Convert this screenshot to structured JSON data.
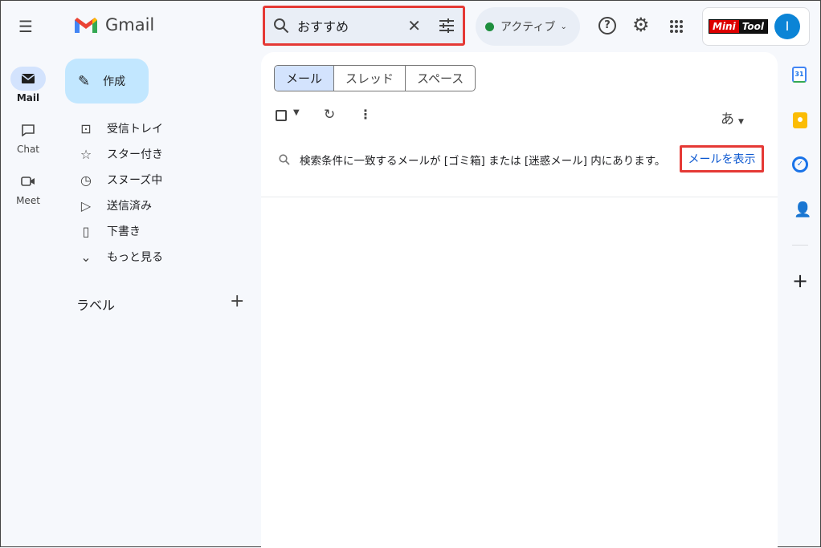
{
  "app": {
    "name": "Gmail"
  },
  "rail": [
    {
      "label": "Mail",
      "icon": "mail-icon"
    },
    {
      "label": "Chat",
      "icon": "chat-icon"
    },
    {
      "label": "Meet",
      "icon": "meet-icon"
    }
  ],
  "compose": "作成",
  "nav": [
    {
      "label": "受信トレイ",
      "icon": "inbox-icon"
    },
    {
      "label": "スター付き",
      "icon": "star-icon"
    },
    {
      "label": "スヌーズ中",
      "icon": "clock-icon"
    },
    {
      "label": "送信済み",
      "icon": "send-icon"
    },
    {
      "label": "下書き",
      "icon": "draft-icon"
    },
    {
      "label": "もっと見る",
      "icon": "chevron-down-icon"
    }
  ],
  "labels_title": "ラベル",
  "search": {
    "value": "おすすめ"
  },
  "status": "アクティブ",
  "brand": {
    "logo": "MiniTool",
    "avatar": "I"
  },
  "tabs": [
    "メール",
    "スレッド",
    "スペース"
  ],
  "toolbar": {
    "input_mode": "あ"
  },
  "notice": {
    "text": "検索条件に一致するメールが [ゴミ箱] または [迷惑メール] 内にあります。",
    "link": "メールを表示"
  },
  "colors": {
    "accent": "#0b57d0",
    "highlight": "#e53935",
    "status": "#1e8e3e"
  }
}
